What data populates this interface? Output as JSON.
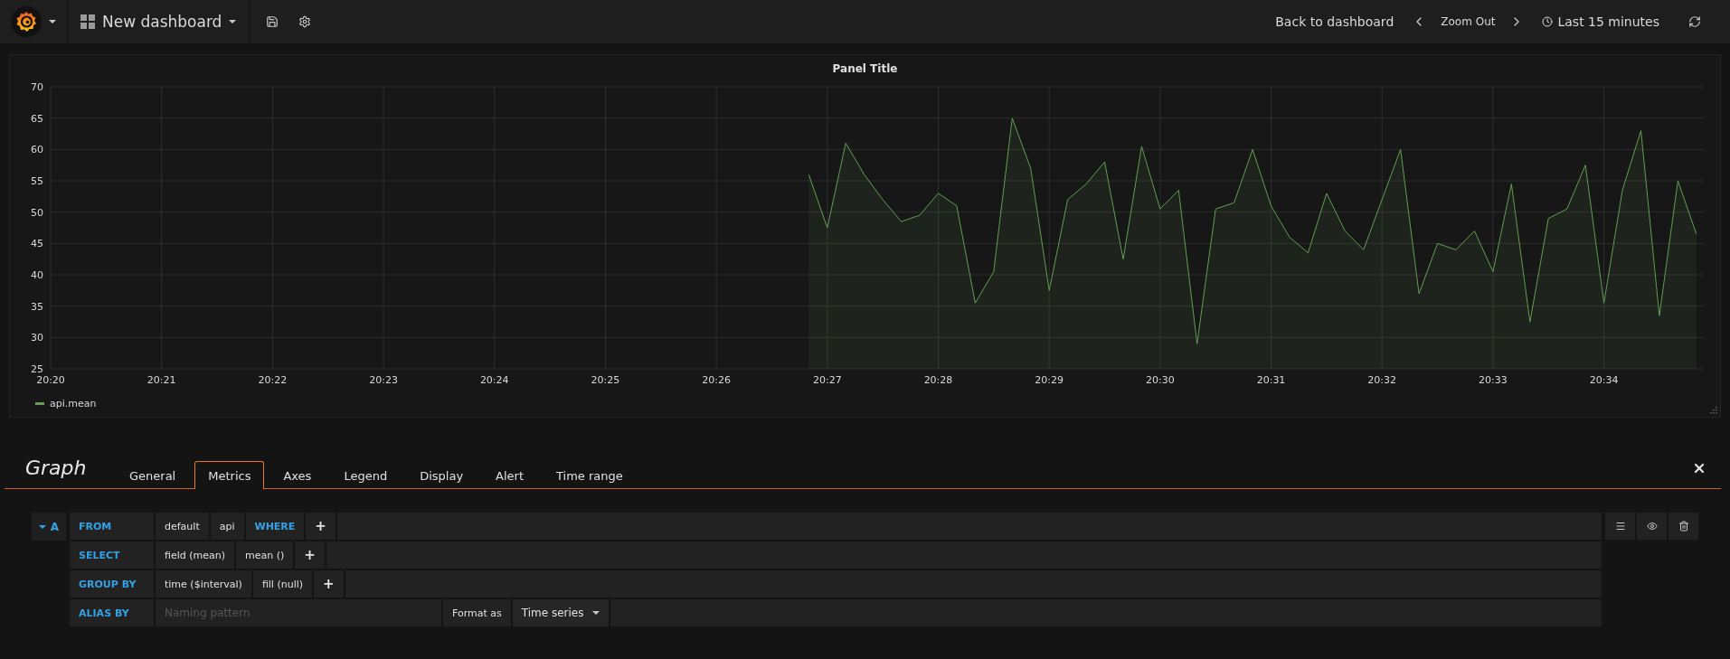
{
  "navbar": {
    "dashboard_title": "New dashboard",
    "back_link": "Back to dashboard",
    "zoom_label": "Zoom Out",
    "time_range": "Last 15 minutes"
  },
  "panel": {
    "title": "Panel Title",
    "chart_data": {
      "type": "area",
      "grid": true,
      "ylim": [
        25,
        70
      ],
      "yticks": [
        25,
        30,
        35,
        40,
        45,
        50,
        55,
        60,
        65,
        70
      ],
      "categories": [
        "20:20",
        null,
        null,
        null,
        null,
        null,
        "20:21",
        null,
        null,
        null,
        null,
        null,
        "20:22",
        null,
        null,
        null,
        null,
        null,
        "20:23",
        null,
        null,
        null,
        null,
        null,
        "20:24",
        null,
        null,
        null,
        null,
        null,
        "20:25",
        null,
        null,
        null,
        null,
        null,
        "20:26",
        null,
        null,
        null,
        null,
        null,
        "20:27",
        null,
        null,
        null,
        null,
        null,
        "20:28",
        null,
        null,
        null,
        null,
        null,
        "20:29",
        null,
        null,
        null,
        null,
        null,
        "20:30",
        null,
        null,
        null,
        null,
        null,
        "20:31",
        null,
        null,
        null,
        null,
        null,
        "20:32",
        null,
        null,
        null,
        null,
        null,
        "20:33",
        null,
        null,
        null,
        null,
        null,
        "20:34",
        null,
        null,
        null,
        null,
        null
      ],
      "series": [
        {
          "name": "api.mean",
          "color": "#629e51",
          "values": [
            null,
            null,
            null,
            null,
            null,
            null,
            null,
            null,
            null,
            null,
            null,
            null,
            null,
            null,
            null,
            null,
            null,
            null,
            null,
            null,
            null,
            null,
            null,
            null,
            null,
            null,
            null,
            null,
            null,
            null,
            null,
            null,
            null,
            null,
            null,
            null,
            null,
            null,
            null,
            null,
            null,
            56,
            47.5,
            61,
            56,
            52,
            48.5,
            49.5,
            53,
            51,
            35.5,
            40.5,
            65,
            57,
            37.5,
            52,
            54.5,
            58,
            42.5,
            60.5,
            50.5,
            53.5,
            29,
            50.5,
            51.5,
            60,
            51,
            46,
            43.5,
            53,
            47,
            44,
            52,
            60,
            37,
            45,
            44,
            47,
            40.5,
            54.5,
            32.5,
            49,
            50.5,
            57.5,
            35.5,
            53.5,
            63,
            33.5,
            55,
            46.5
          ]
        }
      ]
    }
  },
  "editor": {
    "title": "Graph",
    "tabs": [
      {
        "label": "General",
        "selected": false
      },
      {
        "label": "Metrics",
        "selected": true
      },
      {
        "label": "Axes",
        "selected": false
      },
      {
        "label": "Legend",
        "selected": false
      },
      {
        "label": "Display",
        "selected": false
      },
      {
        "label": "Alert",
        "selected": false
      },
      {
        "label": "Time range",
        "selected": false
      }
    ],
    "queries": [
      {
        "ref": "A",
        "expanded": true,
        "rows": [
          {
            "kind": "segments",
            "label": "FROM",
            "segments": [
              {
                "kind": "value",
                "text": "default"
              },
              {
                "kind": "value",
                "text": "api"
              },
              {
                "kind": "keyword",
                "text": "WHERE"
              },
              {
                "kind": "add",
                "text": "+"
              }
            ]
          },
          {
            "kind": "segments",
            "label": "SELECT",
            "segments": [
              {
                "kind": "value",
                "text": "field (mean)"
              },
              {
                "kind": "value",
                "text": "mean ()"
              },
              {
                "kind": "add",
                "text": "+"
              }
            ]
          },
          {
            "kind": "segments",
            "label": "GROUP BY",
            "segments": [
              {
                "kind": "value",
                "text": "time ($interval)"
              },
              {
                "kind": "value",
                "text": "fill (null)"
              },
              {
                "kind": "add",
                "text": "+"
              }
            ]
          },
          {
            "kind": "alias",
            "label": "ALIAS BY",
            "placeholder": "Naming pattern",
            "format_label": "Format as",
            "format_value": "Time series"
          }
        ]
      }
    ]
  }
}
